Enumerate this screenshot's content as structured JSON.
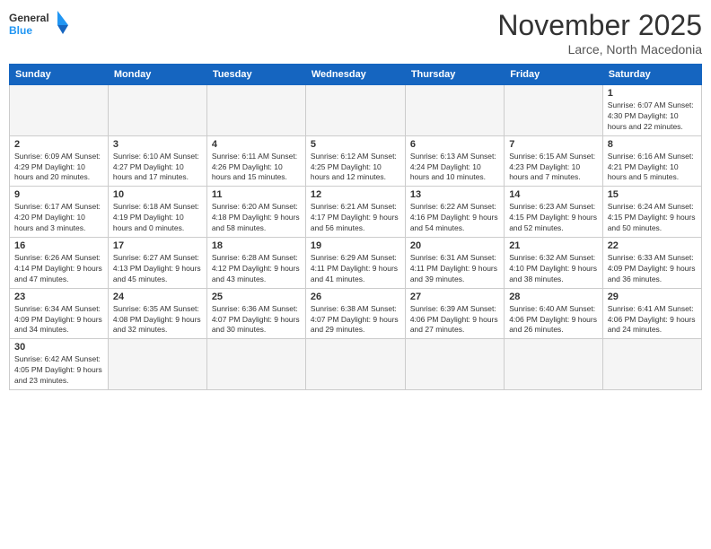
{
  "logo": {
    "text_general": "General",
    "text_blue": "Blue"
  },
  "title": "November 2025",
  "location": "Larce, North Macedonia",
  "days_of_week": [
    "Sunday",
    "Monday",
    "Tuesday",
    "Wednesday",
    "Thursday",
    "Friday",
    "Saturday"
  ],
  "weeks": [
    [
      {
        "day": "",
        "info": ""
      },
      {
        "day": "",
        "info": ""
      },
      {
        "day": "",
        "info": ""
      },
      {
        "day": "",
        "info": ""
      },
      {
        "day": "",
        "info": ""
      },
      {
        "day": "",
        "info": ""
      },
      {
        "day": "1",
        "info": "Sunrise: 6:07 AM\nSunset: 4:30 PM\nDaylight: 10 hours and 22 minutes."
      }
    ],
    [
      {
        "day": "2",
        "info": "Sunrise: 6:09 AM\nSunset: 4:29 PM\nDaylight: 10 hours and 20 minutes."
      },
      {
        "day": "3",
        "info": "Sunrise: 6:10 AM\nSunset: 4:27 PM\nDaylight: 10 hours and 17 minutes."
      },
      {
        "day": "4",
        "info": "Sunrise: 6:11 AM\nSunset: 4:26 PM\nDaylight: 10 hours and 15 minutes."
      },
      {
        "day": "5",
        "info": "Sunrise: 6:12 AM\nSunset: 4:25 PM\nDaylight: 10 hours and 12 minutes."
      },
      {
        "day": "6",
        "info": "Sunrise: 6:13 AM\nSunset: 4:24 PM\nDaylight: 10 hours and 10 minutes."
      },
      {
        "day": "7",
        "info": "Sunrise: 6:15 AM\nSunset: 4:23 PM\nDaylight: 10 hours and 7 minutes."
      },
      {
        "day": "8",
        "info": "Sunrise: 6:16 AM\nSunset: 4:21 PM\nDaylight: 10 hours and 5 minutes."
      }
    ],
    [
      {
        "day": "9",
        "info": "Sunrise: 6:17 AM\nSunset: 4:20 PM\nDaylight: 10 hours and 3 minutes."
      },
      {
        "day": "10",
        "info": "Sunrise: 6:18 AM\nSunset: 4:19 PM\nDaylight: 10 hours and 0 minutes."
      },
      {
        "day": "11",
        "info": "Sunrise: 6:20 AM\nSunset: 4:18 PM\nDaylight: 9 hours and 58 minutes."
      },
      {
        "day": "12",
        "info": "Sunrise: 6:21 AM\nSunset: 4:17 PM\nDaylight: 9 hours and 56 minutes."
      },
      {
        "day": "13",
        "info": "Sunrise: 6:22 AM\nSunset: 4:16 PM\nDaylight: 9 hours and 54 minutes."
      },
      {
        "day": "14",
        "info": "Sunrise: 6:23 AM\nSunset: 4:15 PM\nDaylight: 9 hours and 52 minutes."
      },
      {
        "day": "15",
        "info": "Sunrise: 6:24 AM\nSunset: 4:15 PM\nDaylight: 9 hours and 50 minutes."
      }
    ],
    [
      {
        "day": "16",
        "info": "Sunrise: 6:26 AM\nSunset: 4:14 PM\nDaylight: 9 hours and 47 minutes."
      },
      {
        "day": "17",
        "info": "Sunrise: 6:27 AM\nSunset: 4:13 PM\nDaylight: 9 hours and 45 minutes."
      },
      {
        "day": "18",
        "info": "Sunrise: 6:28 AM\nSunset: 4:12 PM\nDaylight: 9 hours and 43 minutes."
      },
      {
        "day": "19",
        "info": "Sunrise: 6:29 AM\nSunset: 4:11 PM\nDaylight: 9 hours and 41 minutes."
      },
      {
        "day": "20",
        "info": "Sunrise: 6:31 AM\nSunset: 4:11 PM\nDaylight: 9 hours and 39 minutes."
      },
      {
        "day": "21",
        "info": "Sunrise: 6:32 AM\nSunset: 4:10 PM\nDaylight: 9 hours and 38 minutes."
      },
      {
        "day": "22",
        "info": "Sunrise: 6:33 AM\nSunset: 4:09 PM\nDaylight: 9 hours and 36 minutes."
      }
    ],
    [
      {
        "day": "23",
        "info": "Sunrise: 6:34 AM\nSunset: 4:09 PM\nDaylight: 9 hours and 34 minutes."
      },
      {
        "day": "24",
        "info": "Sunrise: 6:35 AM\nSunset: 4:08 PM\nDaylight: 9 hours and 32 minutes."
      },
      {
        "day": "25",
        "info": "Sunrise: 6:36 AM\nSunset: 4:07 PM\nDaylight: 9 hours and 30 minutes."
      },
      {
        "day": "26",
        "info": "Sunrise: 6:38 AM\nSunset: 4:07 PM\nDaylight: 9 hours and 29 minutes."
      },
      {
        "day": "27",
        "info": "Sunrise: 6:39 AM\nSunset: 4:06 PM\nDaylight: 9 hours and 27 minutes."
      },
      {
        "day": "28",
        "info": "Sunrise: 6:40 AM\nSunset: 4:06 PM\nDaylight: 9 hours and 26 minutes."
      },
      {
        "day": "29",
        "info": "Sunrise: 6:41 AM\nSunset: 4:06 PM\nDaylight: 9 hours and 24 minutes."
      }
    ],
    [
      {
        "day": "30",
        "info": "Sunrise: 6:42 AM\nSunset: 4:05 PM\nDaylight: 9 hours and 23 minutes."
      },
      {
        "day": "",
        "info": ""
      },
      {
        "day": "",
        "info": ""
      },
      {
        "day": "",
        "info": ""
      },
      {
        "day": "",
        "info": ""
      },
      {
        "day": "",
        "info": ""
      },
      {
        "day": "",
        "info": ""
      }
    ]
  ]
}
